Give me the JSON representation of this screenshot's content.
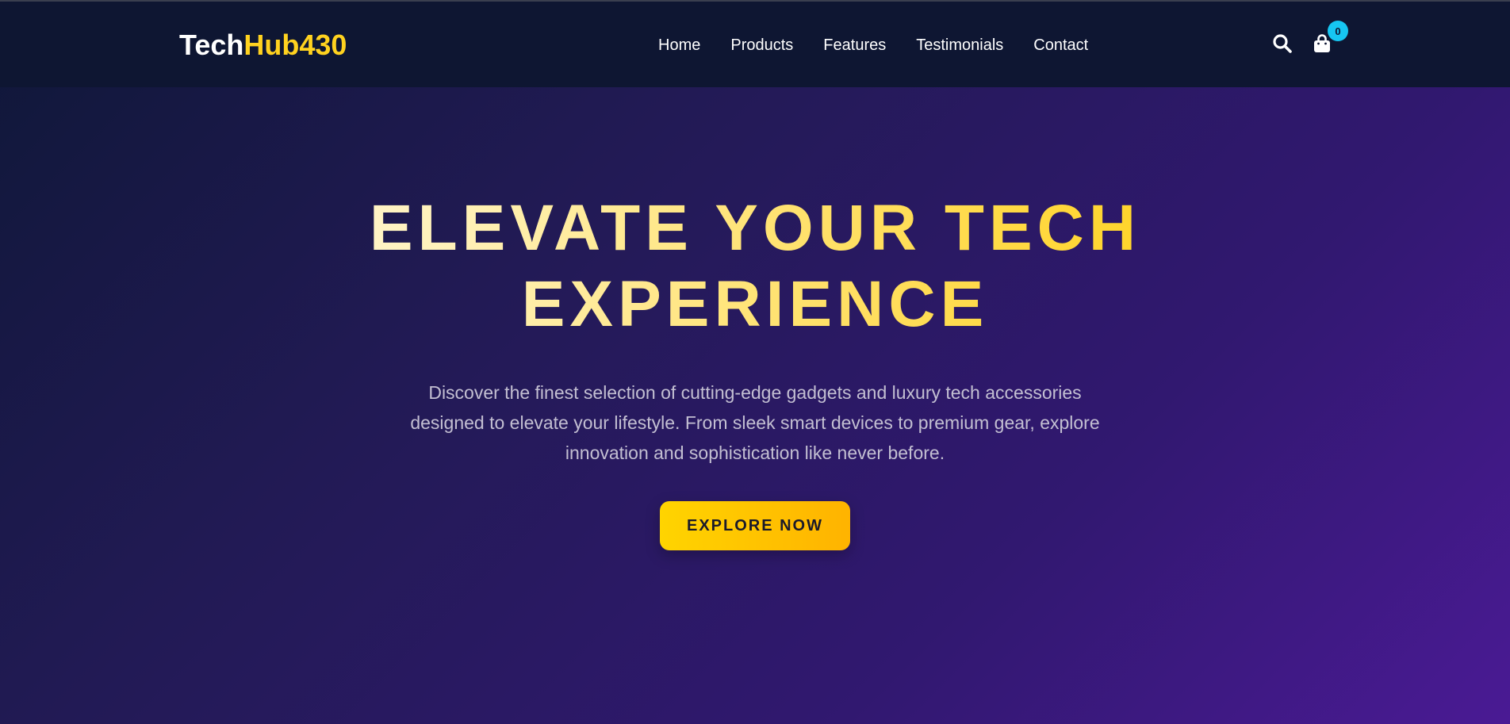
{
  "brand": {
    "name_part1": "Tech",
    "name_part2": "Hub430"
  },
  "nav": {
    "items": [
      {
        "label": "Home"
      },
      {
        "label": "Products"
      },
      {
        "label": "Features"
      },
      {
        "label": "Testimonials"
      },
      {
        "label": "Contact"
      }
    ]
  },
  "header_icons": {
    "search": "search-icon",
    "cart": "shopping-bag-icon",
    "cart_count": "0"
  },
  "hero": {
    "title_line1": "ELEVATE YOUR TECH",
    "title_line2": "EXPERIENCE",
    "description": "Discover the finest selection of cutting-edge gadgets and luxury tech accessories designed to elevate your lifestyle. From sleek smart devices to premium gear, explore innovation and sophistication like never before.",
    "cta_label": "EXPLORE NOW"
  },
  "colors": {
    "header_bg": "#0e1632",
    "accent_yellow": "#ffd21f",
    "badge_cyan": "#16c6f2",
    "bg_gradient_start": "#0f1738",
    "bg_gradient_end": "#4a1a94"
  }
}
